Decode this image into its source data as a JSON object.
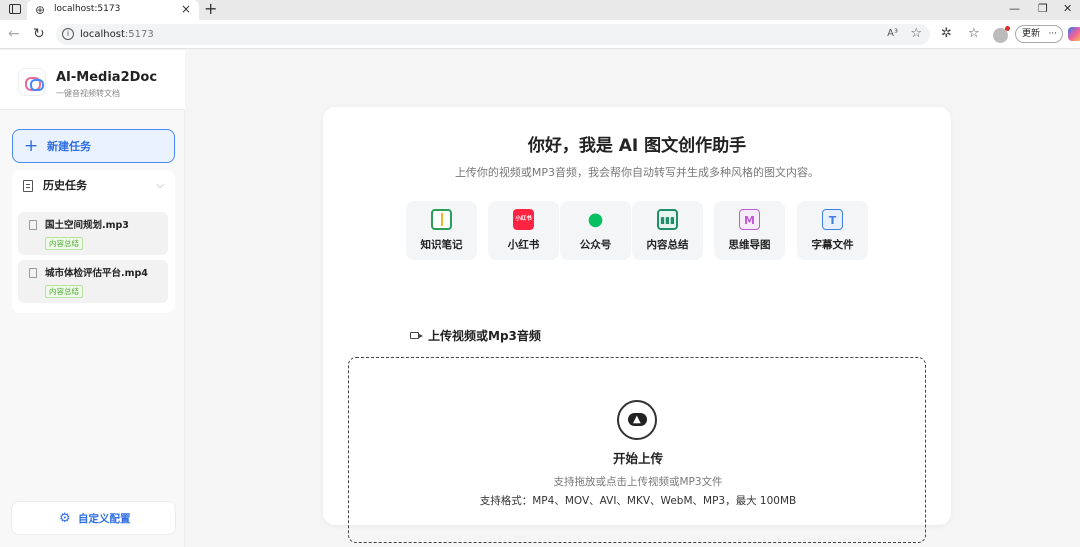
{
  "browser": {
    "tab_title": "localhost:5173",
    "url_host": "localhost",
    "url_port": ":5173",
    "read_aloud": "A³",
    "update_label": "更新",
    "update_more": "···"
  },
  "brand": {
    "name": "AI-Media2Doc",
    "subtitle": "一键音视频转文档"
  },
  "sidebar": {
    "new_task_label": "新建任务",
    "history_label": "历史任务",
    "history_items": [
      {
        "name": "国土空间规划.mp3",
        "badge": "内容总结"
      },
      {
        "name": "城市体检评估平台.mp4",
        "badge": "内容总结"
      }
    ],
    "config_label": "自定义配置"
  },
  "main": {
    "title": "你好，我是 AI 图文创作助手",
    "subtitle": "上传你的视频或MP3音频，我会帮你自动转写并生成多种风格的图文内容。",
    "features": [
      {
        "label": "知识笔记",
        "icon": "notebook-icon",
        "color": "#2e9c5a"
      },
      {
        "label": "小红书",
        "icon": "xiaohongshu-icon",
        "color": "#ff2442",
        "icon_text": "小红书"
      },
      {
        "label": "公众号",
        "icon": "wechat-icon",
        "color": "#07c160"
      },
      {
        "label": "内容总结",
        "icon": "summary-chart-icon",
        "color": "#1f8f6a"
      },
      {
        "label": "思维导图",
        "icon": "mindmap-icon",
        "color": "#c05bd6",
        "icon_text": "M"
      },
      {
        "label": "字幕文件",
        "icon": "subtitle-icon",
        "color": "#3f7fe0",
        "icon_text": "T"
      }
    ],
    "upload_heading": "上传视频或Mp3音频",
    "upload_start": "开始上传",
    "upload_hint": "支持拖放或点击上传视频或MP3文件",
    "upload_formats": "支持格式：MP4、MOV、AVI、MKV、WebM、MP3，最大 100MB"
  },
  "colors": {
    "accent": "#2f6fe4",
    "badge_green": "#52a83b"
  }
}
